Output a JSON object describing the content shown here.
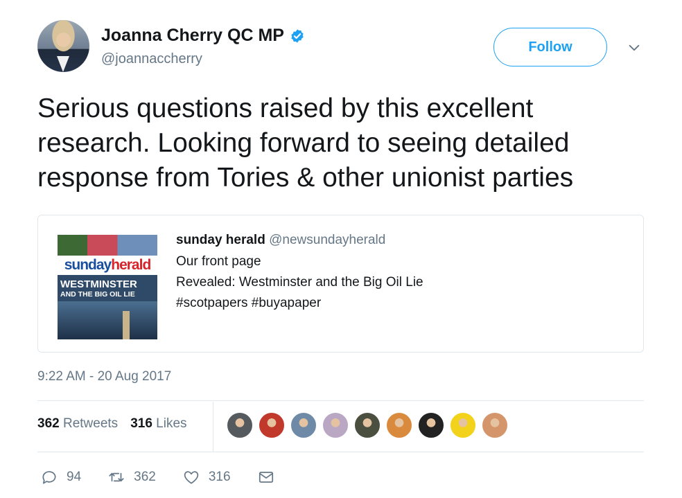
{
  "author": {
    "name": "Joanna Cherry QC MP",
    "handle": "@joannaccherry",
    "verified": true
  },
  "follow_label": "Follow",
  "tweet_text": "Serious questions raised by this excellent research. Looking forward to seeing detailed response from Tories & other unionist parties",
  "quoted_card": {
    "author_name": "sunday herald",
    "author_handle": "@newsundayherald",
    "lines": [
      "Our front page",
      "Revealed: Westminster and the Big Oil Lie",
      "#scotpapers #buyapaper"
    ],
    "thumbnail": {
      "masthead_a": "sunday",
      "masthead_b": "herald",
      "headline": "WESTMINSTER",
      "subheadline": "AND THE BIG OIL LIE"
    }
  },
  "timestamp": "9:22 AM - 20 Aug 2017",
  "stats": {
    "retweets_count": "362",
    "retweets_label": "Retweets",
    "likes_count": "316",
    "likes_label": "Likes"
  },
  "likers_colors": [
    "#555a5e",
    "#c0392b",
    "#6f8aa6",
    "#b9a7c4",
    "#4a4f3f",
    "#d98a3c",
    "#222222",
    "#f2d21b",
    "#d4956a"
  ],
  "actions": {
    "reply_count": "94",
    "retweet_count": "362",
    "like_count": "316"
  },
  "colors": {
    "accent": "#1da1f2",
    "secondary_text": "#657786",
    "border": "#e1e8ed"
  }
}
